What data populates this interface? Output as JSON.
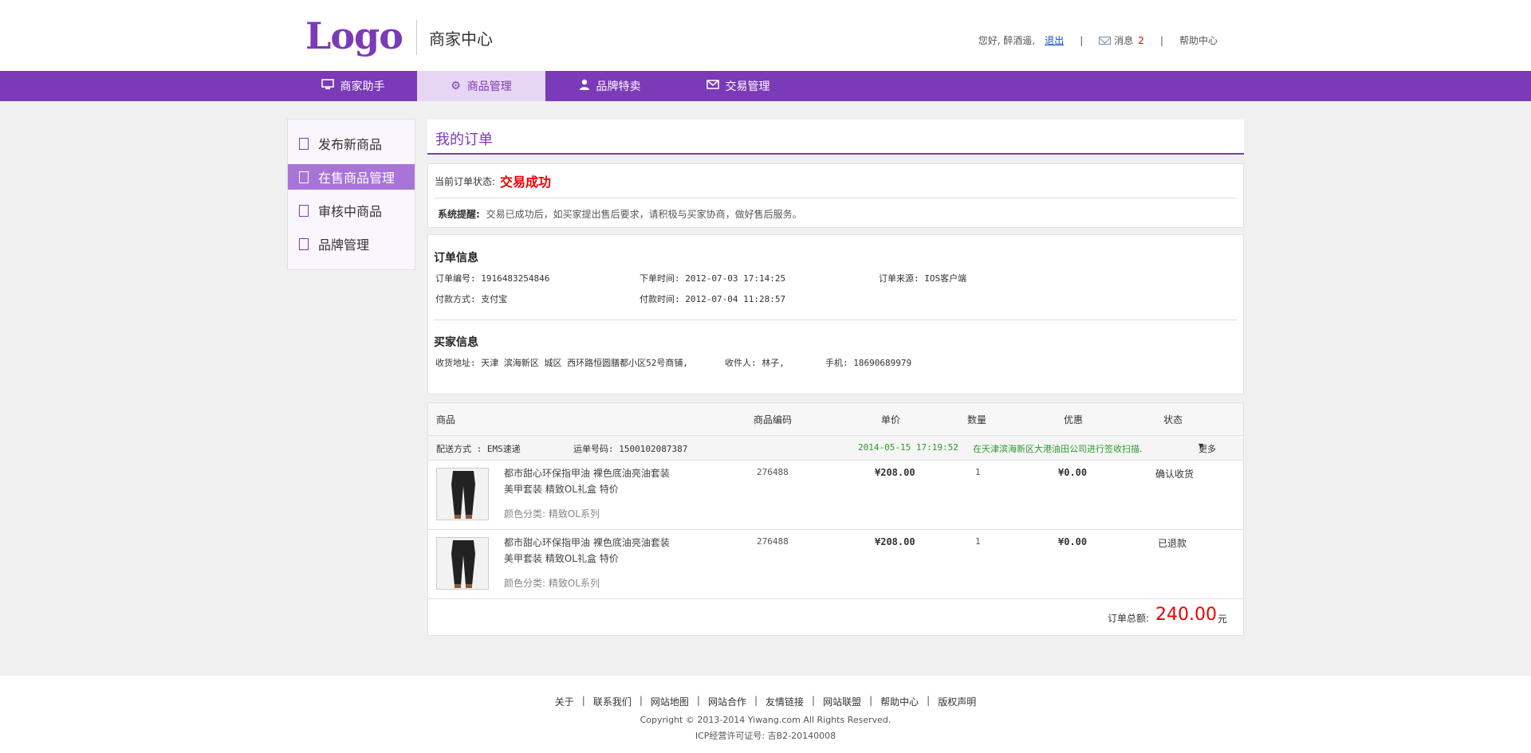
{
  "header": {
    "logo": "Logo",
    "site_title": "商家中心",
    "greeting": "您好, 醉酒遥,",
    "logout": "退出",
    "messages_label": "消息",
    "messages_count": "2",
    "help": "帮助中心"
  },
  "nav": {
    "items": [
      {
        "label": "商家助手",
        "icon": "monitor-icon"
      },
      {
        "label": "商品管理",
        "icon": "gear-icon"
      },
      {
        "label": "品牌特卖",
        "icon": "user-icon"
      },
      {
        "label": "交易管理",
        "icon": "mail-icon"
      }
    ],
    "active": 1
  },
  "sidebar": {
    "items": [
      {
        "label": "发布新商品"
      },
      {
        "label": "在售商品管理"
      },
      {
        "label": "审核中商品"
      },
      {
        "label": "品牌管理"
      }
    ],
    "active": 1
  },
  "main": {
    "title": "我的订单",
    "status_label": "当前订单状态:",
    "status_value": "交易成功",
    "notice_label": "系统提醒:",
    "notice_text": "交易已成功后，如买家提出售后要求，请积极与买家协商，做好售后服务。",
    "order_info": {
      "title": "订单信息",
      "order_no": "订单编号: 1916483254846",
      "order_time": "下单时间: 2012-07-03  17:14:25",
      "order_source": "订单来源: IOS客户端",
      "pay_method": "付款方式: 支付宝",
      "pay_time": "付款时间: 2012-07-04  11:28:57"
    },
    "buyer_info": {
      "title": "买家信息",
      "address": "收货地址: 天津 滨海新区 城区 西环路恒圆膳都小区52号商铺,",
      "receiver": "收件人: 林子,",
      "phone": "手机: 18690689979"
    },
    "goods": {
      "headers": [
        "商品",
        "商品编码",
        "单价",
        "数量",
        "优惠",
        "状态"
      ],
      "shipping": {
        "method": "配送方式 : EMS速递",
        "tracking": "运单号码: 1500102087387",
        "time": "2014-05-15 17:19:52",
        "event": "在天津滨海新区大港油田公司进行签收扫描.",
        "more": "更多"
      },
      "rows": [
        {
          "name1": "都市甜心环保指甲油 裸色底油亮油套装",
          "name2": "美甲套装 精致OL礼盒 特价",
          "variant": "颜色分类:  精致OL系列",
          "code": "276488",
          "price": "¥208.00",
          "qty": "1",
          "discount": "¥0.00",
          "status": "确认收货"
        },
        {
          "name1": "都市甜心环保指甲油 裸色底油亮油套装",
          "name2": "美甲套装 精致OL礼盒 特价",
          "variant": "颜色分类:  精致OL系列",
          "code": "276488",
          "price": "¥208.00",
          "qty": "1",
          "discount": "¥0.00",
          "status": "已退款"
        }
      ],
      "total_label": "订单总额:",
      "total_value": "240.00",
      "total_unit": "元"
    }
  },
  "footer": {
    "links": [
      "关于",
      "联系我们",
      "网站地图",
      "网站合作",
      "友情链接",
      "网站联盟",
      "帮助中心",
      "版权声明"
    ],
    "copyright": "Copyright © 2013-2014 Yiwang.com All Rights Reserved.",
    "icp": "ICP经营许可证号: 吉B2-20140008"
  },
  "colors": {
    "brand": "#7b3ab7",
    "accent_red": "#e00000",
    "green": "#2c9a2c"
  }
}
